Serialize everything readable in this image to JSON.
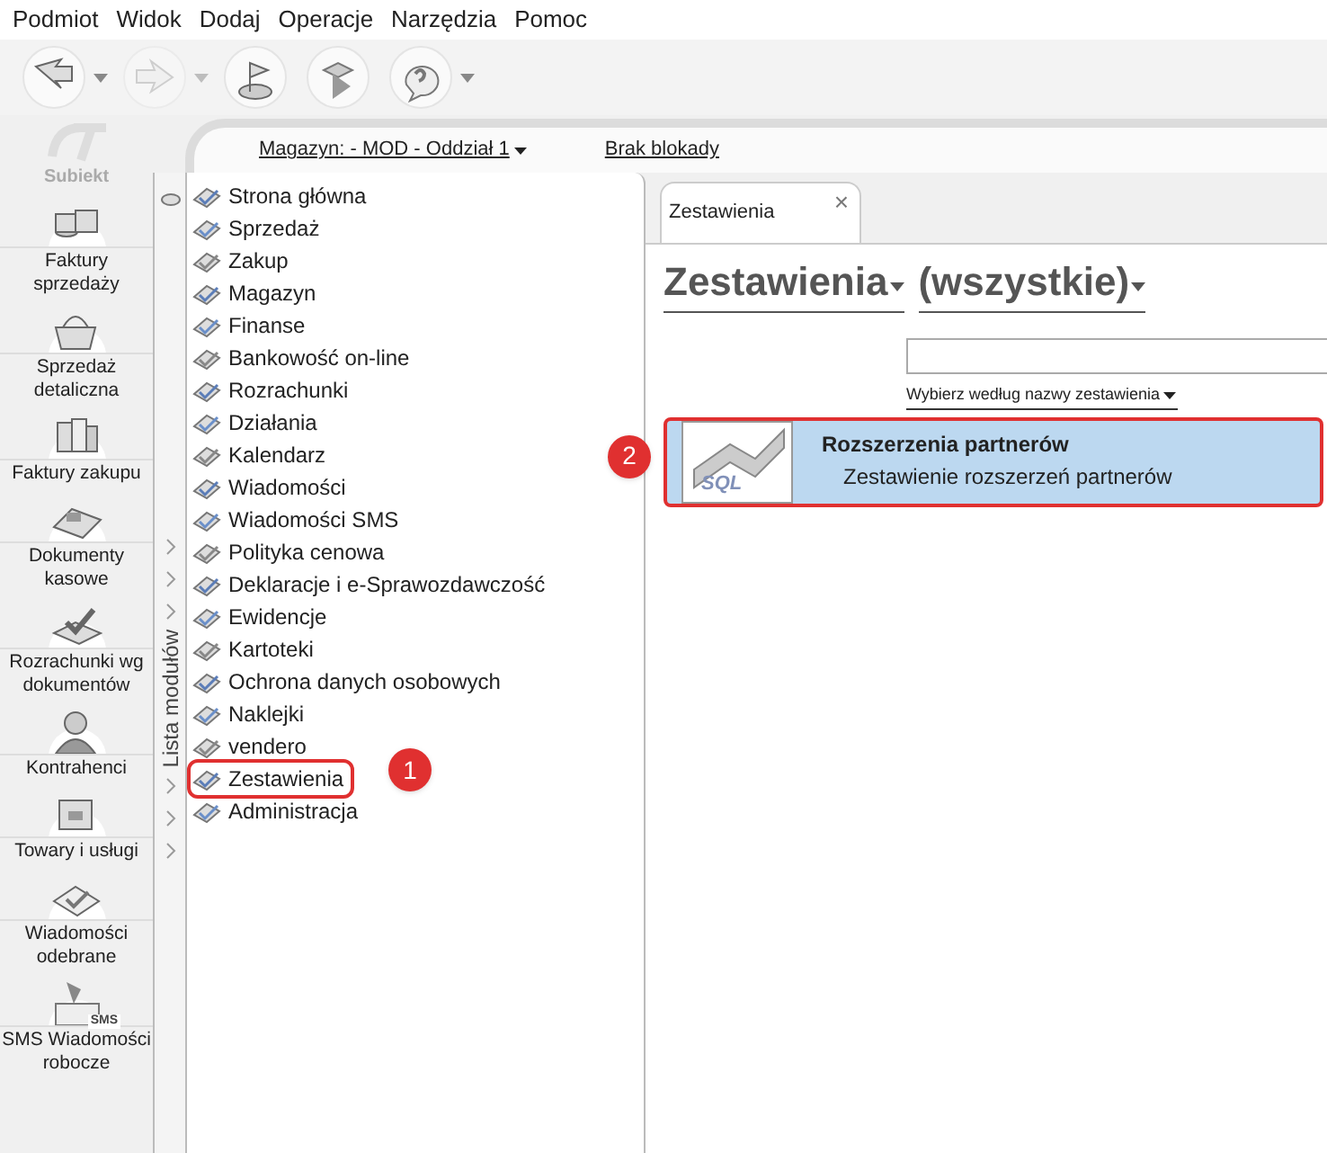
{
  "menu": [
    "Podmiot",
    "Widok",
    "Dodaj",
    "Operacje",
    "Narzędzia",
    "Pomoc"
  ],
  "toolbar": [
    {
      "kind": "arrow-left",
      "dropdown": true,
      "disabled": false
    },
    {
      "kind": "arrow-right",
      "dropdown": true,
      "disabled": true
    },
    {
      "kind": "flag",
      "dropdown": false,
      "disabled": false
    },
    {
      "kind": "play",
      "dropdown": false,
      "disabled": false
    },
    {
      "kind": "help",
      "dropdown": true,
      "disabled": false
    }
  ],
  "logo": {
    "text": "Subiekt"
  },
  "sidebar": {
    "items": [
      {
        "label": "Faktury sprzedaży",
        "kind": "coins"
      },
      {
        "label": "Sprzedaż detaliczna",
        "kind": "basket"
      },
      {
        "label": "Faktury zakupu",
        "kind": "books"
      },
      {
        "label": "Dokumenty kasowe",
        "kind": "register"
      },
      {
        "label": "Rozrachunki wg dokumentów",
        "kind": "check"
      },
      {
        "label": "Kontrahenci",
        "kind": "person"
      },
      {
        "label": "Towary i usługi",
        "kind": "box"
      },
      {
        "label": "Wiadomości odebrane",
        "kind": "envelope"
      },
      {
        "label": "SMS Wiadomości robocze",
        "kind": "sms",
        "icon_text": "SMS"
      }
    ]
  },
  "top_bar": {
    "warehouse": "Magazyn: - MOD - Oddział 1",
    "lock": "Brak blokady"
  },
  "module_strip": {
    "title": "Lista modułów"
  },
  "modules": [
    {
      "label": "Strona główna",
      "highlighted": false
    },
    {
      "label": "Sprzedaż",
      "highlighted": false
    },
    {
      "label": "Zakup",
      "highlighted": false
    },
    {
      "label": "Magazyn",
      "highlighted": false
    },
    {
      "label": "Finanse",
      "highlighted": false
    },
    {
      "label": "Bankowość on-line",
      "highlighted": false
    },
    {
      "label": "Rozrachunki",
      "highlighted": false
    },
    {
      "label": "Działania",
      "highlighted": false
    },
    {
      "label": "Kalendarz",
      "highlighted": false
    },
    {
      "label": "Wiadomości",
      "highlighted": false
    },
    {
      "label": "Wiadomości SMS",
      "highlighted": false
    },
    {
      "label": "Polityka cenowa",
      "highlighted": false
    },
    {
      "label": "Deklaracje i e-Sprawozdawczość",
      "highlighted": false
    },
    {
      "label": "Ewidencje",
      "highlighted": false
    },
    {
      "label": "Kartoteki",
      "highlighted": false
    },
    {
      "label": "Ochrona danych osobowych",
      "highlighted": false
    },
    {
      "label": "Naklejki",
      "highlighted": false
    },
    {
      "label": "vendero",
      "highlighted": false
    },
    {
      "label": "Zestawienia",
      "highlighted": true
    },
    {
      "label": "Administracja",
      "highlighted": false
    }
  ],
  "tab": {
    "label": "Zestawienia",
    "close": "×"
  },
  "heading": {
    "title": "Zestawienia",
    "filter": "(wszystkie)"
  },
  "search": {
    "hint_link": "Wybierz według nazwy zestawienia"
  },
  "reports": [
    {
      "title": "Rozszerzenia partnerów",
      "description": "Zestawienie rozszerzeń partnerów",
      "icon_text": "SQL",
      "selected": true,
      "highlighted": true
    }
  ],
  "callouts": [
    {
      "number": "1"
    },
    {
      "number": "2"
    }
  ]
}
